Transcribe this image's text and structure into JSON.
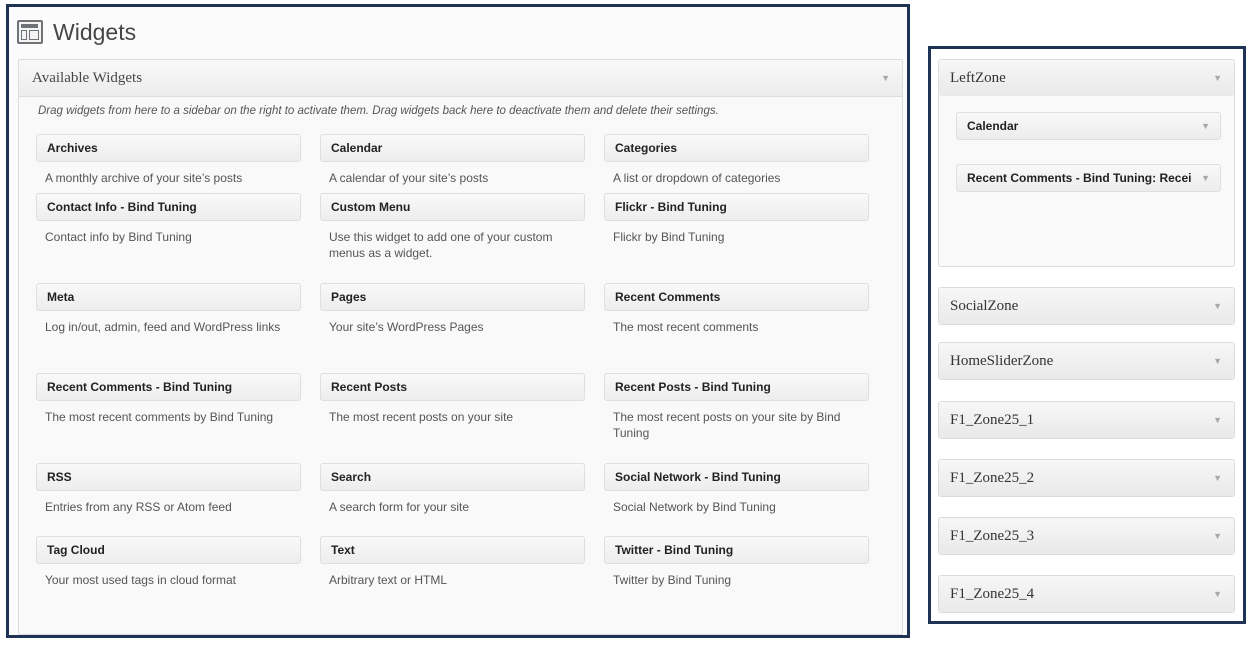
{
  "page": {
    "title": "Widgets",
    "icon": "widgets-icon"
  },
  "available": {
    "title": "Available Widgets",
    "description": "Drag widgets from here to a sidebar on the right to activate them. Drag widgets back here to deactivate them and delete their settings.",
    "widgets": [
      {
        "name": "Archives",
        "desc": "A monthly archive of your site’s posts"
      },
      {
        "name": "Calendar",
        "desc": "A calendar of your site’s posts"
      },
      {
        "name": "Categories",
        "desc": "A list or dropdown of categories"
      },
      {
        "name": "Contact Info - Bind Tuning",
        "desc": "Contact info by Bind Tuning"
      },
      {
        "name": "Custom Menu",
        "desc": "Use this widget to add one of your custom menus as a widget."
      },
      {
        "name": "Flickr - Bind Tuning",
        "desc": "Flickr by Bind Tuning"
      },
      {
        "name": "Meta",
        "desc": "Log in/out, admin, feed and WordPress links"
      },
      {
        "name": "Pages",
        "desc": "Your site’s WordPress Pages"
      },
      {
        "name": "Recent Comments",
        "desc": "The most recent comments"
      },
      {
        "name": "Recent Comments - Bind Tuning",
        "desc": "The most recent comments by Bind Tuning"
      },
      {
        "name": "Recent Posts",
        "desc": "The most recent posts on your site"
      },
      {
        "name": "Recent Posts - Bind Tuning",
        "desc": "The most recent posts on your site by Bind Tuning"
      },
      {
        "name": "RSS",
        "desc": "Entries from any RSS or Atom feed"
      },
      {
        "name": "Search",
        "desc": "A search form for your site"
      },
      {
        "name": "Social Network - Bind Tuning",
        "desc": "Social Network by Bind Tuning"
      },
      {
        "name": "Tag Cloud",
        "desc": "Your most used tags in cloud format"
      },
      {
        "name": "Text",
        "desc": "Arbitrary text or HTML"
      },
      {
        "name": "Twitter - Bind Tuning",
        "desc": "Twitter by Bind Tuning"
      }
    ]
  },
  "sidebars": {
    "zones": [
      {
        "title": "LeftZone",
        "expanded": true
      },
      {
        "title": "SocialZone"
      },
      {
        "title": "HomeSliderZone"
      },
      {
        "title": "F1_Zone25_1"
      },
      {
        "title": "F1_Zone25_2"
      },
      {
        "title": "F1_Zone25_3"
      },
      {
        "title": "F1_Zone25_4"
      }
    ],
    "leftzone_widgets": [
      {
        "name": "Calendar"
      },
      {
        "name": "Recent Comments - Bind Tuning: Recei"
      }
    ]
  },
  "colors": {
    "frame": "#1f3354",
    "caret": "#a8a8a8"
  },
  "icons": {
    "toggle": "caret-down-icon"
  }
}
